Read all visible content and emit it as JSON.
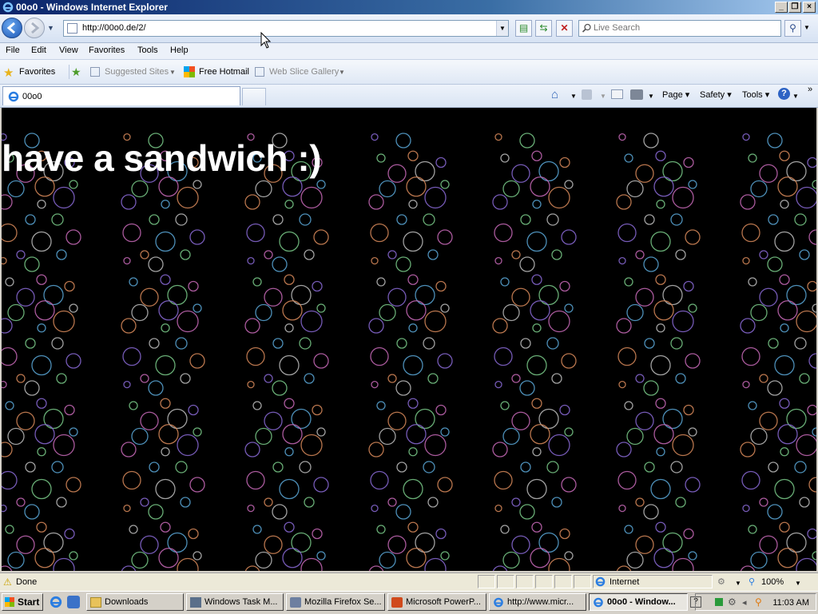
{
  "window": {
    "title": "00o0 - Windows Internet Explorer"
  },
  "address": {
    "url": "http://00o0.de/2/"
  },
  "search": {
    "placeholder": "Live Search"
  },
  "menu": [
    "File",
    "Edit",
    "View",
    "Favorites",
    "Tools",
    "Help"
  ],
  "favorites_bar": {
    "favorites_label": "Favorites",
    "items": [
      "Suggested Sites",
      "Free Hotmail",
      "Web Slice Gallery"
    ]
  },
  "tab": {
    "label": "00o0"
  },
  "command_bar": {
    "page": "Page",
    "safety": "Safety",
    "tools": "Tools"
  },
  "page": {
    "heading": "have a sandwich :)"
  },
  "status": {
    "text": "Done",
    "zone": "Internet",
    "zoom": "100%"
  },
  "taskbar": {
    "start": "Start",
    "tasks": [
      "Downloads",
      "Windows Task M...",
      "Mozilla Firefox Se...",
      "Microsoft PowerP...",
      "http://www.micr...",
      "00o0 - Window..."
    ],
    "clock": "11:03 AM"
  },
  "colors": {
    "page_background": "#000000",
    "heading": "#ffffff",
    "titlebar": "#0a246a"
  }
}
